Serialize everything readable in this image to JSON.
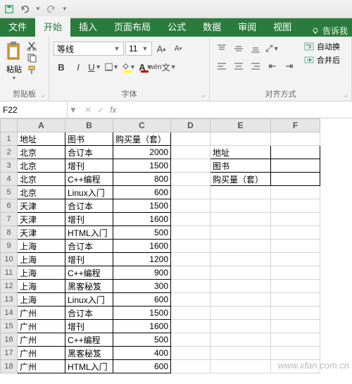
{
  "qat": {
    "save": "save-icon",
    "undo": "undo-icon",
    "redo": "redo-icon"
  },
  "tabs": {
    "file": "文件",
    "home": "开始",
    "insert": "插入",
    "layout": "页面布局",
    "formulas": "公式",
    "data": "数据",
    "review": "审阅",
    "view": "视图",
    "tell": "告诉我"
  },
  "ribbon": {
    "clipboard": {
      "paste": "粘贴",
      "label": "剪贴板"
    },
    "font": {
      "name": "等线",
      "size": "11",
      "label": "字体"
    },
    "align": {
      "wrap": "自动换",
      "merge": "合并后",
      "label": "对齐方式"
    }
  },
  "namebox": "F22",
  "headers": [
    "A",
    "B",
    "C",
    "D",
    "E",
    "F"
  ],
  "rows": [
    {
      "a": "地址",
      "b": "图书",
      "c": "购买量（套）",
      "e": ""
    },
    {
      "a": "北京",
      "b": "合订本",
      "c": "2000",
      "e": "地址"
    },
    {
      "a": "北京",
      "b": "增刊",
      "c": "1500",
      "e": "图书"
    },
    {
      "a": "北京",
      "b": "C++编程",
      "c": "800",
      "e": "购买量（套）"
    },
    {
      "a": "北京",
      "b": "Linux入门",
      "c": "600",
      "e": ""
    },
    {
      "a": "天津",
      "b": "合订本",
      "c": "1500",
      "e": ""
    },
    {
      "a": "天津",
      "b": "增刊",
      "c": "1600",
      "e": ""
    },
    {
      "a": "天津",
      "b": "HTML入门",
      "c": "500",
      "e": ""
    },
    {
      "a": "上海",
      "b": "合订本",
      "c": "1600",
      "e": ""
    },
    {
      "a": "上海",
      "b": "增刊",
      "c": "1200",
      "e": ""
    },
    {
      "a": "上海",
      "b": "C++编程",
      "c": "900",
      "e": ""
    },
    {
      "a": "上海",
      "b": "黑客秘笈",
      "c": "300",
      "e": ""
    },
    {
      "a": "上海",
      "b": "Linux入门",
      "c": "600",
      "e": ""
    },
    {
      "a": "广州",
      "b": "合订本",
      "c": "1500",
      "e": ""
    },
    {
      "a": "广州",
      "b": "增刊",
      "c": "1600",
      "e": ""
    },
    {
      "a": "广州",
      "b": "C++编程",
      "c": "500",
      "e": ""
    },
    {
      "a": "广州",
      "b": "黑客秘笈",
      "c": "400",
      "e": ""
    },
    {
      "a": "广州",
      "b": "HTML入门",
      "c": "600",
      "e": ""
    }
  ],
  "watermark": "www.xfan.com.cn"
}
